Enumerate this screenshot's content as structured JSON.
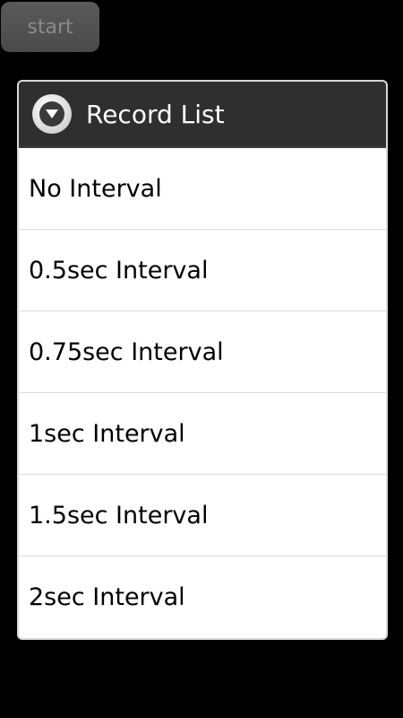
{
  "start_button": {
    "label": "start"
  },
  "dialog": {
    "title": "Record List",
    "icon": "dropdown-circle-icon",
    "items": [
      {
        "label": "No Interval"
      },
      {
        "label": "0.5sec Interval"
      },
      {
        "label": "0.75sec Interval"
      },
      {
        "label": "1sec Interval"
      },
      {
        "label": "1.5sec Interval"
      },
      {
        "label": "2sec Interval"
      }
    ]
  },
  "colors": {
    "background": "#000000",
    "header_bg": "#2f2f2f",
    "list_bg": "#ffffff",
    "start_button_bg": "#4f4f4f"
  }
}
